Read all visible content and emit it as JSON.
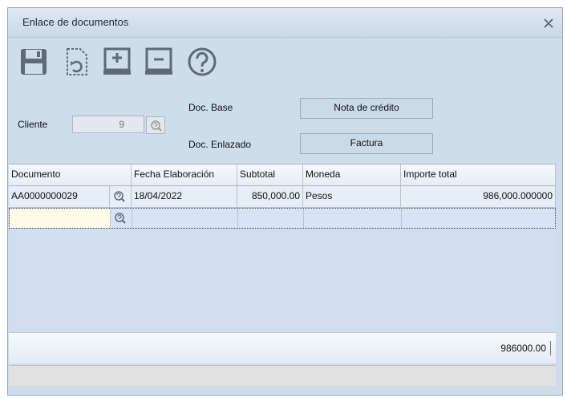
{
  "window": {
    "title": "Enlace de documentos"
  },
  "toolbar": {
    "icons": [
      "save-icon",
      "refresh-document-icon",
      "add-row-icon",
      "remove-row-icon",
      "help-icon"
    ]
  },
  "form": {
    "cliente_label": "Cliente",
    "cliente_value": "9",
    "doc_base_label": "Doc. Base",
    "doc_base_value": "Nota de crédito",
    "doc_enlazado_label": "Doc. Enlazado",
    "doc_enlazado_value": "Factura"
  },
  "grid": {
    "columns": [
      "Documento",
      "Fecha Elaboración",
      "Subtotal",
      "Moneda",
      "Importe total"
    ],
    "rows": [
      {
        "documento": "AA0000000029",
        "fecha": "18/04/2022",
        "subtotal": "850,000.00",
        "moneda": "Pesos",
        "importe": "986,000.000000"
      },
      {
        "documento": "",
        "fecha": "",
        "subtotal": "",
        "moneda": "",
        "importe": ""
      }
    ],
    "total": "986000.00"
  }
}
